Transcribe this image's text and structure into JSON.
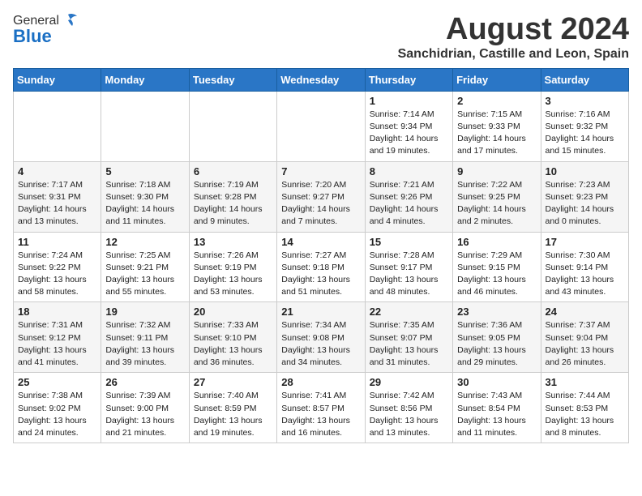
{
  "header": {
    "logo_general": "General",
    "logo_blue": "Blue",
    "month_year": "August 2024",
    "location": "Sanchidrian, Castille and Leon, Spain"
  },
  "weekdays": [
    "Sunday",
    "Monday",
    "Tuesday",
    "Wednesday",
    "Thursday",
    "Friday",
    "Saturday"
  ],
  "weeks": [
    [
      {
        "day": "",
        "info": ""
      },
      {
        "day": "",
        "info": ""
      },
      {
        "day": "",
        "info": ""
      },
      {
        "day": "",
        "info": ""
      },
      {
        "day": "1",
        "info": "Sunrise: 7:14 AM\nSunset: 9:34 PM\nDaylight: 14 hours\nand 19 minutes."
      },
      {
        "day": "2",
        "info": "Sunrise: 7:15 AM\nSunset: 9:33 PM\nDaylight: 14 hours\nand 17 minutes."
      },
      {
        "day": "3",
        "info": "Sunrise: 7:16 AM\nSunset: 9:32 PM\nDaylight: 14 hours\nand 15 minutes."
      }
    ],
    [
      {
        "day": "4",
        "info": "Sunrise: 7:17 AM\nSunset: 9:31 PM\nDaylight: 14 hours\nand 13 minutes."
      },
      {
        "day": "5",
        "info": "Sunrise: 7:18 AM\nSunset: 9:30 PM\nDaylight: 14 hours\nand 11 minutes."
      },
      {
        "day": "6",
        "info": "Sunrise: 7:19 AM\nSunset: 9:28 PM\nDaylight: 14 hours\nand 9 minutes."
      },
      {
        "day": "7",
        "info": "Sunrise: 7:20 AM\nSunset: 9:27 PM\nDaylight: 14 hours\nand 7 minutes."
      },
      {
        "day": "8",
        "info": "Sunrise: 7:21 AM\nSunset: 9:26 PM\nDaylight: 14 hours\nand 4 minutes."
      },
      {
        "day": "9",
        "info": "Sunrise: 7:22 AM\nSunset: 9:25 PM\nDaylight: 14 hours\nand 2 minutes."
      },
      {
        "day": "10",
        "info": "Sunrise: 7:23 AM\nSunset: 9:23 PM\nDaylight: 14 hours\nand 0 minutes."
      }
    ],
    [
      {
        "day": "11",
        "info": "Sunrise: 7:24 AM\nSunset: 9:22 PM\nDaylight: 13 hours\nand 58 minutes."
      },
      {
        "day": "12",
        "info": "Sunrise: 7:25 AM\nSunset: 9:21 PM\nDaylight: 13 hours\nand 55 minutes."
      },
      {
        "day": "13",
        "info": "Sunrise: 7:26 AM\nSunset: 9:19 PM\nDaylight: 13 hours\nand 53 minutes."
      },
      {
        "day": "14",
        "info": "Sunrise: 7:27 AM\nSunset: 9:18 PM\nDaylight: 13 hours\nand 51 minutes."
      },
      {
        "day": "15",
        "info": "Sunrise: 7:28 AM\nSunset: 9:17 PM\nDaylight: 13 hours\nand 48 minutes."
      },
      {
        "day": "16",
        "info": "Sunrise: 7:29 AM\nSunset: 9:15 PM\nDaylight: 13 hours\nand 46 minutes."
      },
      {
        "day": "17",
        "info": "Sunrise: 7:30 AM\nSunset: 9:14 PM\nDaylight: 13 hours\nand 43 minutes."
      }
    ],
    [
      {
        "day": "18",
        "info": "Sunrise: 7:31 AM\nSunset: 9:12 PM\nDaylight: 13 hours\nand 41 minutes."
      },
      {
        "day": "19",
        "info": "Sunrise: 7:32 AM\nSunset: 9:11 PM\nDaylight: 13 hours\nand 39 minutes."
      },
      {
        "day": "20",
        "info": "Sunrise: 7:33 AM\nSunset: 9:10 PM\nDaylight: 13 hours\nand 36 minutes."
      },
      {
        "day": "21",
        "info": "Sunrise: 7:34 AM\nSunset: 9:08 PM\nDaylight: 13 hours\nand 34 minutes."
      },
      {
        "day": "22",
        "info": "Sunrise: 7:35 AM\nSunset: 9:07 PM\nDaylight: 13 hours\nand 31 minutes."
      },
      {
        "day": "23",
        "info": "Sunrise: 7:36 AM\nSunset: 9:05 PM\nDaylight: 13 hours\nand 29 minutes."
      },
      {
        "day": "24",
        "info": "Sunrise: 7:37 AM\nSunset: 9:04 PM\nDaylight: 13 hours\nand 26 minutes."
      }
    ],
    [
      {
        "day": "25",
        "info": "Sunrise: 7:38 AM\nSunset: 9:02 PM\nDaylight: 13 hours\nand 24 minutes."
      },
      {
        "day": "26",
        "info": "Sunrise: 7:39 AM\nSunset: 9:00 PM\nDaylight: 13 hours\nand 21 minutes."
      },
      {
        "day": "27",
        "info": "Sunrise: 7:40 AM\nSunset: 8:59 PM\nDaylight: 13 hours\nand 19 minutes."
      },
      {
        "day": "28",
        "info": "Sunrise: 7:41 AM\nSunset: 8:57 PM\nDaylight: 13 hours\nand 16 minutes."
      },
      {
        "day": "29",
        "info": "Sunrise: 7:42 AM\nSunset: 8:56 PM\nDaylight: 13 hours\nand 13 minutes."
      },
      {
        "day": "30",
        "info": "Sunrise: 7:43 AM\nSunset: 8:54 PM\nDaylight: 13 hours\nand 11 minutes."
      },
      {
        "day": "31",
        "info": "Sunrise: 7:44 AM\nSunset: 8:53 PM\nDaylight: 13 hours\nand 8 minutes."
      }
    ]
  ]
}
